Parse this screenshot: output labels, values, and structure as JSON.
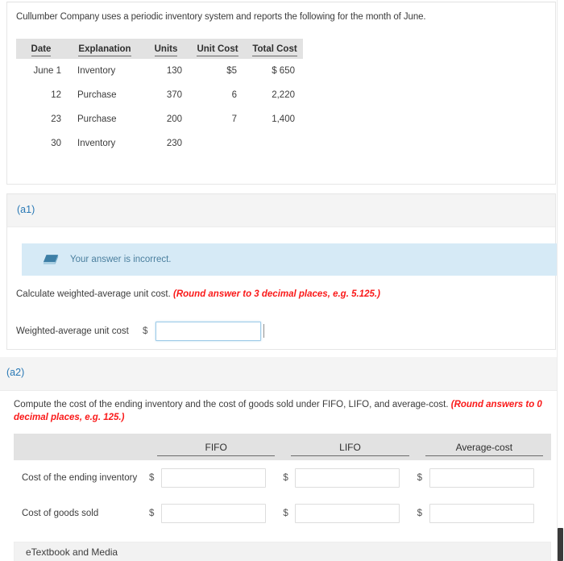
{
  "problem": {
    "statement": "Cullumber Company uses a periodic inventory system and reports the following for the month of June.",
    "table": {
      "headers": [
        "Date",
        "Explanation",
        "Units",
        "Unit Cost",
        "Total Cost"
      ],
      "rows": [
        {
          "date": "June 1",
          "explanation": "Inventory",
          "units": "130",
          "unit_cost": "$5",
          "total_cost": "$ 650"
        },
        {
          "date": "12",
          "explanation": "Purchase",
          "units": "370",
          "unit_cost": "6",
          "total_cost": "2,220"
        },
        {
          "date": "23",
          "explanation": "Purchase",
          "units": "200",
          "unit_cost": "7",
          "total_cost": "1,400"
        },
        {
          "date": "30",
          "explanation": "Inventory",
          "units": "230",
          "unit_cost": "",
          "total_cost": ""
        }
      ]
    }
  },
  "a1": {
    "label": "(a1)",
    "alert": {
      "icon": "eraser-icon",
      "message": "Your answer is incorrect.",
      "background_color": "#d6eaf6",
      "text_color": "#4a7f9e"
    },
    "instruction_text": "Calculate weighted-average unit cost.",
    "instruction_note": "(Round answer to 3 decimal places, e.g. 5.125.)",
    "note_color": "#fa1919",
    "answer_label": "Weighted-average unit cost",
    "currency_symbol": "$",
    "answer_value": "",
    "answer_placeholder": ""
  },
  "a2": {
    "label": "(a2)",
    "instruction_text": "Compute the cost of the ending inventory and the cost of goods sold under FIFO, LIFO, and average-cost.",
    "instruction_note": "(Round answers to 0 decimal places, e.g. 125.)",
    "note_color": "#fa1919",
    "table": {
      "headers": [
        "",
        "FIFO",
        "LIFO",
        "Average-cost"
      ],
      "currency_symbol": "$",
      "rows": [
        {
          "label": "Cost of the ending inventory",
          "fifo": "",
          "lifo": "",
          "average_cost": ""
        },
        {
          "label": "Cost of goods sold",
          "fifo": "",
          "lifo": "",
          "average_cost": ""
        }
      ]
    }
  },
  "footer": {
    "etextbook_label": "eTextbook and Media"
  },
  "theme": {
    "section_label_color": "#2878b5",
    "table_header_bg": "#e2e2e2",
    "section_header_bg": "#f4f4f4"
  }
}
